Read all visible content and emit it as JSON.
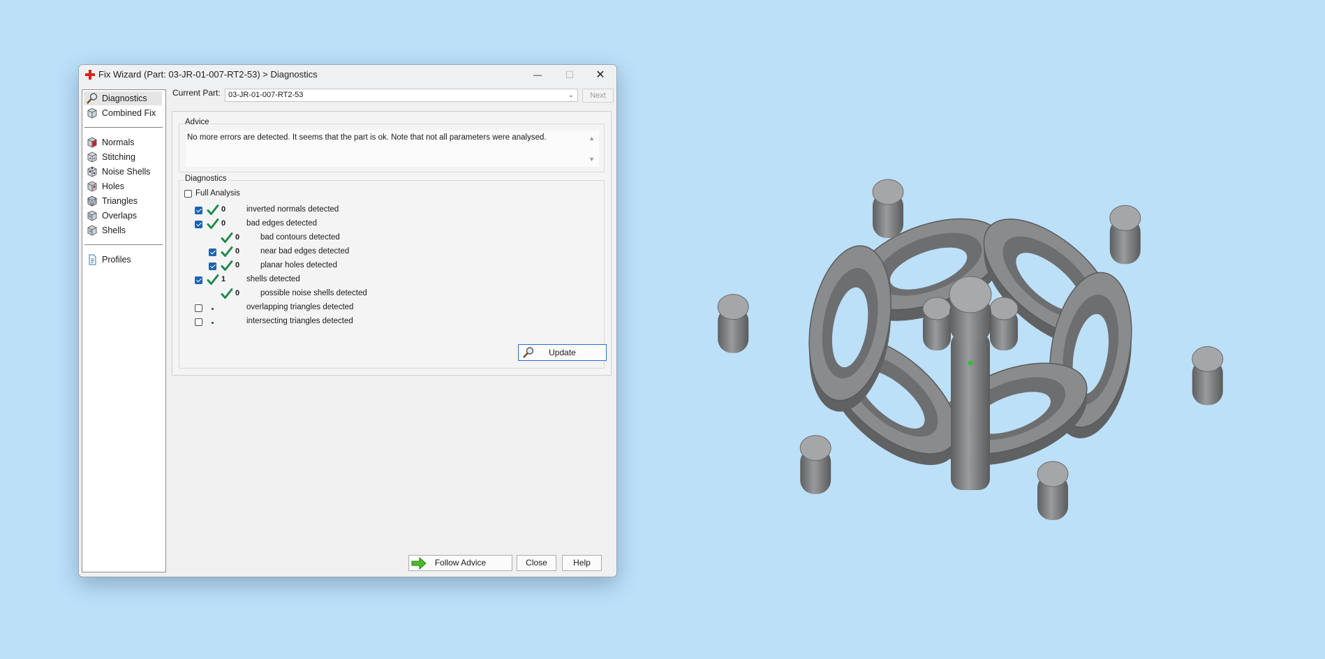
{
  "window": {
    "title": "Fix Wizard (Part: 03-JR-01-007-RT2-53) > Diagnostics",
    "controls": {
      "minimize": "—",
      "maximize": "☐",
      "close": "✕"
    }
  },
  "sidebar": {
    "items": [
      {
        "label": "Diagnostics",
        "icon": "magnifier-icon",
        "selected": true
      },
      {
        "label": "Combined Fix",
        "icon": "cube-icon"
      },
      {
        "label": "Normals",
        "icon": "normals-cube-icon"
      },
      {
        "label": "Stitching",
        "icon": "stitching-cube-icon"
      },
      {
        "label": "Noise Shells",
        "icon": "noise-shells-cube-icon"
      },
      {
        "label": "Holes",
        "icon": "holes-cube-icon"
      },
      {
        "label": "Triangles",
        "icon": "triangles-cube-icon"
      },
      {
        "label": "Overlaps",
        "icon": "overlaps-cube-icon"
      },
      {
        "label": "Shells",
        "icon": "shells-cube-icon"
      },
      {
        "label": "Profiles",
        "icon": "document-icon"
      }
    ]
  },
  "current_part": {
    "label": "Current Part:",
    "value": "03-JR-01-007-RT2-53",
    "next_label": "Next"
  },
  "advice": {
    "title": "Advice",
    "text": "No more errors are detected. It seems that the part is ok. Note that not all parameters were analysed."
  },
  "diagnostics": {
    "title": "Diagnostics",
    "full_analysis_label": "Full Analysis",
    "full_analysis_checked": false,
    "rows": [
      {
        "checkbox": true,
        "checked": true,
        "ok": true,
        "count": "0",
        "text": "inverted normals detected",
        "indent": 0
      },
      {
        "checkbox": true,
        "checked": true,
        "ok": true,
        "count": "0",
        "text": "bad edges detected",
        "indent": 0
      },
      {
        "checkbox": false,
        "checked": false,
        "ok": true,
        "count": "0",
        "text": "bad contours detected",
        "indent": 1
      },
      {
        "checkbox": true,
        "checked": true,
        "ok": true,
        "count": "0",
        "text": "near bad edges detected",
        "indent": 1
      },
      {
        "checkbox": true,
        "checked": true,
        "ok": true,
        "count": "0",
        "text": "planar holes detected",
        "indent": 1
      },
      {
        "checkbox": true,
        "checked": true,
        "ok": true,
        "count": "1",
        "text": "shells detected",
        "indent": 0
      },
      {
        "checkbox": false,
        "checked": false,
        "ok": true,
        "count": "0",
        "text": "possible noise shells detected",
        "indent": 1
      },
      {
        "checkbox": true,
        "checked": false,
        "ok": false,
        "count": "",
        "text": "overlapping triangles detected",
        "indent": 0
      },
      {
        "checkbox": true,
        "checked": false,
        "ok": false,
        "count": "",
        "text": "intersecting triangles detected",
        "indent": 0
      }
    ],
    "update_label": "Update"
  },
  "footer": {
    "follow_advice_label": "Follow Advice",
    "close_label": "Close",
    "help_label": "Help"
  },
  "colors": {
    "background": "#bde0f9",
    "checkbox_on": "#1d63b1",
    "ok_check": "#1f8a4c",
    "model": "#8a8b8c"
  }
}
